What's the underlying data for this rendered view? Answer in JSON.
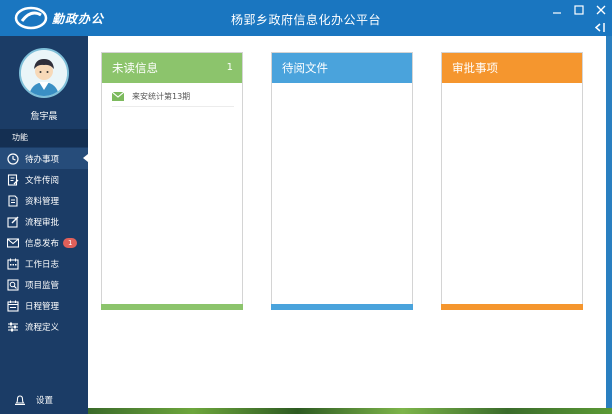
{
  "app": {
    "name": "勤政办公",
    "window_title": "杨郢乡政府信息化办公平台"
  },
  "user": {
    "name": "詹宇晨"
  },
  "sidebar": {
    "section_label": "功能",
    "items": [
      {
        "label": "待办事项",
        "icon": "clock-icon",
        "active": true
      },
      {
        "label": "文件传阅",
        "icon": "file-edit-icon"
      },
      {
        "label": "资料管理",
        "icon": "document-icon"
      },
      {
        "label": "流程审批",
        "icon": "edit-icon"
      },
      {
        "label": "信息发布",
        "icon": "mail-icon",
        "badge": "1"
      },
      {
        "label": "工作日志",
        "icon": "calendar-icon"
      },
      {
        "label": "项目监管",
        "icon": "monitor-icon"
      },
      {
        "label": "日程管理",
        "icon": "schedule-icon"
      },
      {
        "label": "流程定义",
        "icon": "sliders-icon"
      }
    ],
    "settings_label": "设置"
  },
  "panels": {
    "unread": {
      "title": "未读信息",
      "count": "1",
      "color": "#8cc46c",
      "items": [
        "来安统计第13期"
      ]
    },
    "pending_docs": {
      "title": "待阅文件",
      "color": "#4aa3dc"
    },
    "approvals": {
      "title": "审批事项",
      "color": "#f5962e"
    }
  },
  "colors": {
    "titlebar": "#1a76c0",
    "sidebar": "#1b3c66",
    "badge": "#e0605a"
  }
}
